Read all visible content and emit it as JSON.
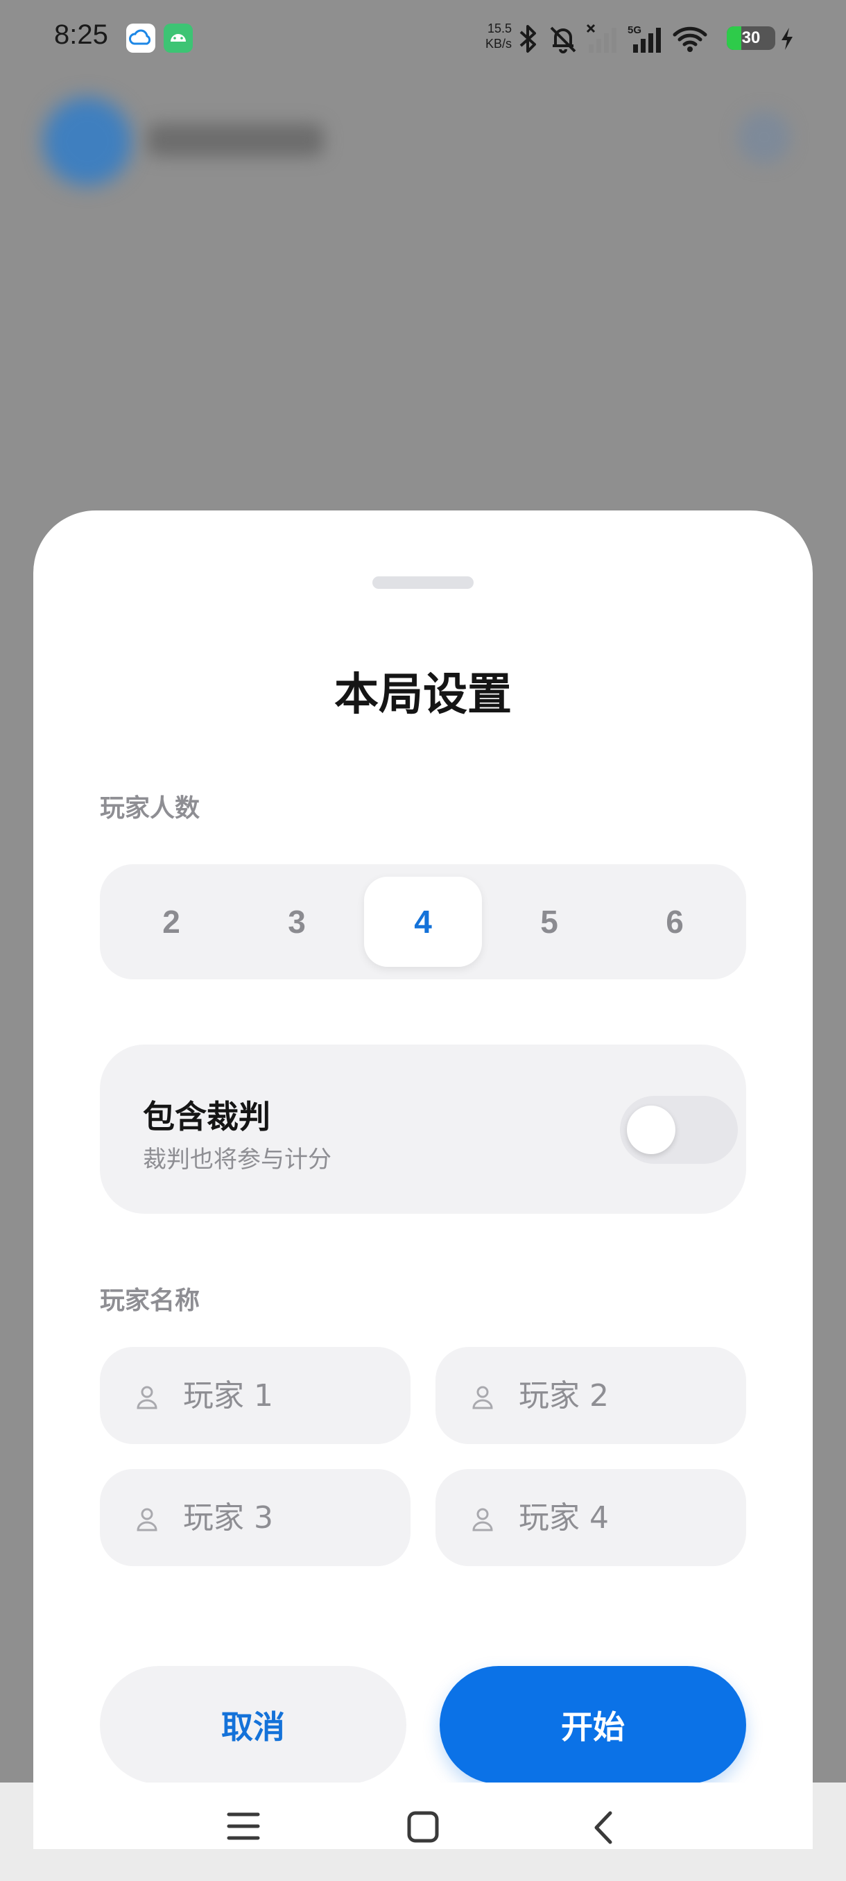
{
  "status_bar": {
    "time": "8:25",
    "net_speed_value": "15.5",
    "net_speed_unit": "KB/s",
    "battery_level": "30",
    "icons": [
      "cloud-app-icon",
      "android-app-icon",
      "bluetooth-icon",
      "bell-muted-icon",
      "signal-off-icon",
      "signal-5g-icon",
      "wifi-icon",
      "battery-icon",
      "charging-icon"
    ]
  },
  "sheet": {
    "title": "本局设置",
    "player_count": {
      "label": "玩家人数",
      "options": [
        "2",
        "3",
        "4",
        "5",
        "6"
      ],
      "selected": "4"
    },
    "referee": {
      "title": "包含裁判",
      "subtitle": "裁判也将参与计分",
      "enabled": false
    },
    "player_names": {
      "label": "玩家名称",
      "placeholders": [
        "玩家 1",
        "玩家 2",
        "玩家 3",
        "玩家 4"
      ]
    },
    "actions": {
      "cancel": "取消",
      "start": "开始"
    }
  },
  "colors": {
    "accent": "#0b72e7",
    "scrim": "#8f8f8f",
    "surface": "#f2f2f4"
  },
  "nav_bar": {
    "icons": [
      "menu-icon",
      "home-icon",
      "back-icon"
    ]
  }
}
